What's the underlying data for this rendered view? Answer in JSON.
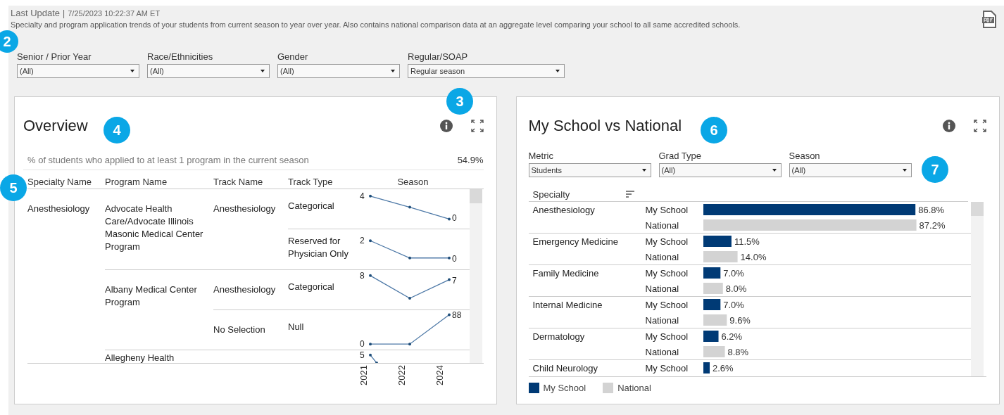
{
  "header": {
    "update_label": "Last Update",
    "separator": "|",
    "update_value": "7/25/2023 10:22:37 AM ET",
    "description": "Specialty and program application trends of your students from current season to year over year. Also contains national comparison data at an aggregate level comparing your school to all same accredited schools."
  },
  "filters": [
    {
      "label": "Senior / Prior Year",
      "value": "(All)"
    },
    {
      "label": "Race/Ethnicities",
      "value": "(All)"
    },
    {
      "label": "Gender",
      "value": "(All)"
    },
    {
      "label": "Regular/SOAP",
      "value": "Regular season"
    }
  ],
  "overview": {
    "title": "Overview",
    "summary_label": "% of students who applied to at least 1 program in the current season",
    "summary_value": "54.9%",
    "columns": [
      "Specialty Name",
      "Program Name",
      "Track Name",
      "Track Type",
      "Season"
    ],
    "specialties": [
      {
        "name": "Anesthesiology",
        "programs": [
          {
            "name": "Advocate Health Care/Advocate Illinois Masonic Medical Center Program",
            "tracks": [
              {
                "name": "Anesthesiology",
                "types": [
                  {
                    "name": "Categorical",
                    "trend": {
                      "kind": "down",
                      "start": "4",
                      "end": "0"
                    }
                  },
                  {
                    "name": "Reserved for Physician Only",
                    "trend": {
                      "kind": "down-flat",
                      "start": "2",
                      "end": "0"
                    }
                  }
                ]
              }
            ]
          },
          {
            "name": "Albany Medical Center Program",
            "tracks": [
              {
                "name": "Anesthesiology",
                "types": [
                  {
                    "name": "Categorical",
                    "trend": {
                      "kind": "v",
                      "start": "8",
                      "end": "7"
                    }
                  }
                ]
              },
              {
                "name": "No Selection",
                "types": [
                  {
                    "name": "Null",
                    "trend": {
                      "kind": "up",
                      "start": "0",
                      "end": "88"
                    }
                  }
                ]
              }
            ]
          },
          {
            "name": "Allegheny Health",
            "tracks": [
              {
                "types": [
                  {
                    "trend": {
                      "kind": "cut",
                      "start": "5"
                    }
                  }
                ]
              }
            ]
          }
        ]
      }
    ],
    "years": [
      "2021",
      "2022",
      "2024"
    ]
  },
  "comparison": {
    "title": "My School vs National",
    "filters": [
      {
        "label": "Metric",
        "value": "Students"
      },
      {
        "label": "Grad Type",
        "value": "(All)"
      },
      {
        "label": "Season",
        "value": "(All)"
      }
    ],
    "column": "Specialty",
    "chart_data": {
      "type": "bar",
      "orientation": "horizontal",
      "legend": "bottom",
      "data_labels": true,
      "categories": [
        "Anesthesiology",
        "Emergency Medicine",
        "Family Medicine",
        "Internal Medicine",
        "Dermatology",
        "Child Neurology"
      ],
      "series": [
        {
          "name": "My School",
          "color": "#003a75",
          "values": [
            86.8,
            11.5,
            7.0,
            7.0,
            6.2,
            2.6
          ],
          "value_labels": [
            "86.8%",
            "11.5%",
            "7.0%",
            "7.0%",
            "6.2%",
            "2.6%"
          ]
        },
        {
          "name": "National",
          "color": "#d3d3d3",
          "values": [
            87.2,
            14.0,
            8.0,
            9.6,
            8.8,
            null
          ],
          "value_labels": [
            "87.2%",
            "14.0%",
            "8.0%",
            "9.6%",
            "8.8%",
            null
          ]
        }
      ]
    }
  },
  "callouts": [
    "2",
    "3",
    "4",
    "5",
    "6",
    "7"
  ]
}
